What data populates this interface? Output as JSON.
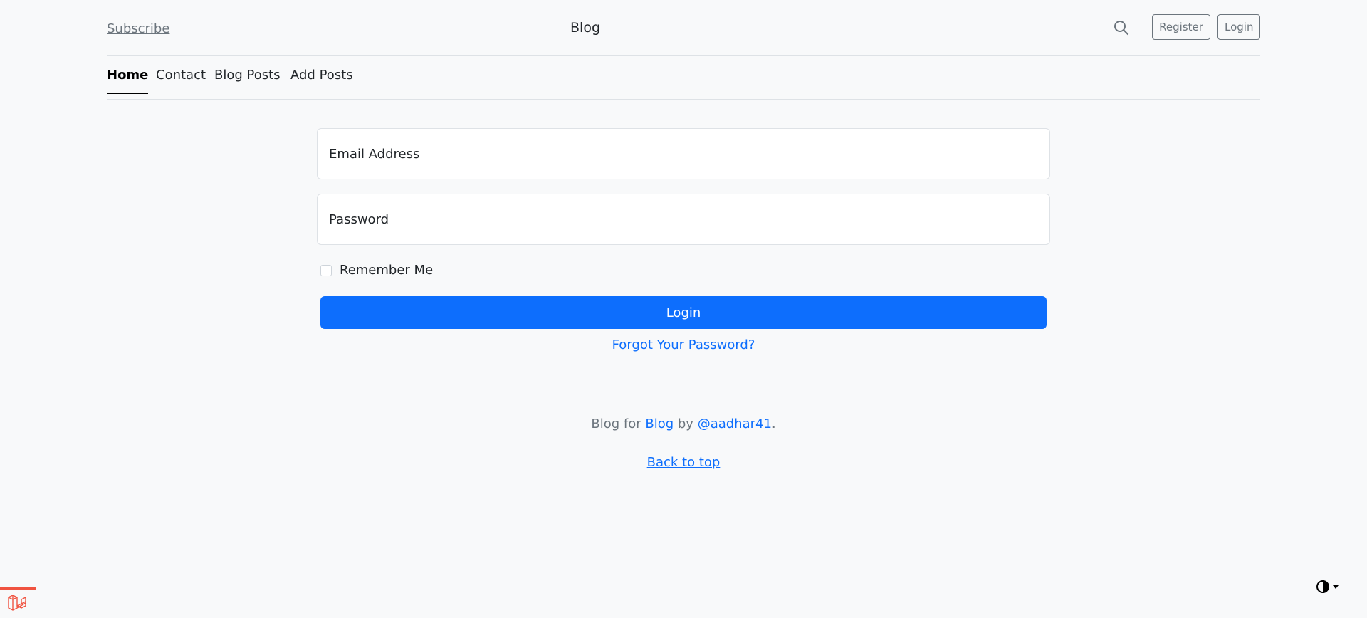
{
  "header": {
    "subscribe_label": "Subscribe",
    "brand": "Blog",
    "search_icon": "search-icon",
    "register_label": "Register",
    "login_label": "Login"
  },
  "nav": {
    "items": [
      {
        "label": "Home",
        "active": true
      },
      {
        "label": "Contact",
        "active": false
      },
      {
        "label": "Blog Posts",
        "active": false
      },
      {
        "label": "Add Posts",
        "active": false
      }
    ]
  },
  "form": {
    "email_placeholder": "Email Address",
    "email_value": "",
    "password_placeholder": "Password",
    "password_value": "",
    "remember_label": "Remember Me",
    "remember_checked": false,
    "submit_label": "Login",
    "forgot_label": "Forgot Your Password?"
  },
  "footer": {
    "prefix": "Blog for",
    "blog_link": "Blog",
    "by_text": "by",
    "author_link": "@aadhar41",
    "suffix": ".",
    "back_to_top": "Back to top"
  },
  "widgets": {
    "laravel_icon": "laravel-logo-icon",
    "theme_icon": "contrast-icon"
  },
  "colors": {
    "primary": "#0d6efd",
    "background": "#f8f9fa",
    "muted": "#6c757d",
    "laravel_red": "#f05340"
  }
}
